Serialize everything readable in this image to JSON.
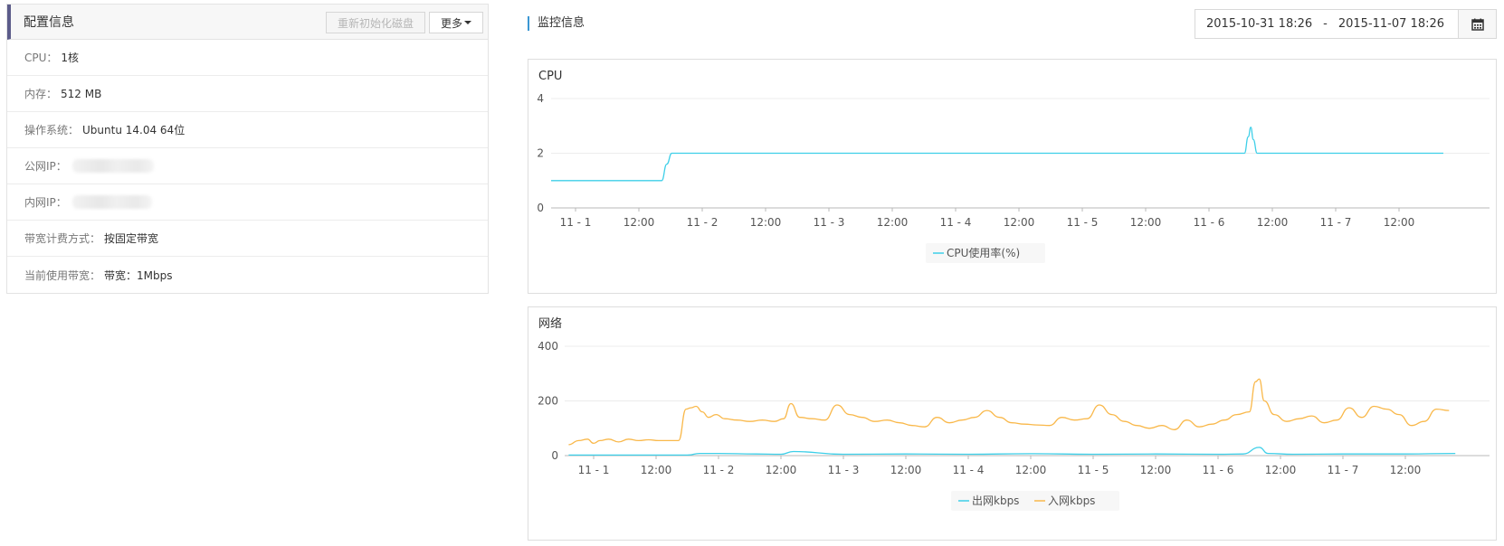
{
  "config": {
    "title": "配置信息",
    "reinit_label": "重新初始化磁盘",
    "more_label": "更多",
    "rows": [
      {
        "label": "CPU：",
        "value": "1核"
      },
      {
        "label": "内存：",
        "value": "512 MB"
      },
      {
        "label": "操作系统：",
        "value": "Ubuntu 14.04 64位"
      },
      {
        "label": "公网IP：",
        "value": ""
      },
      {
        "label": "内网IP：",
        "value": ""
      },
      {
        "label": "带宽计费方式：",
        "value": "按固定带宽"
      },
      {
        "label": "当前使用带宽：",
        "value": "带宽：1Mbps"
      }
    ]
  },
  "monitor": {
    "title": "监控信息",
    "date_start": "2015-10-31 18:26",
    "date_sep": "-",
    "date_end": "2015-11-07 18:26"
  },
  "colors": {
    "series_cyan": "#3ecfe8",
    "series_orange": "#f9b84a",
    "accent_blue": "#3b97d3",
    "header_bar": "#5c5c8a"
  },
  "chart_data": [
    {
      "type": "line",
      "title": "CPU",
      "x_ticks": [
        "11 - 1",
        "12:00",
        "11 - 2",
        "12:00",
        "11 - 3",
        "12:00",
        "11 - 4",
        "12:00",
        "11 - 5",
        "12:00",
        "11 - 6",
        "12:00",
        "11 - 7",
        "12:00"
      ],
      "ylim": [
        0,
        4
      ],
      "y_ticks": [
        0,
        2,
        4
      ],
      "grid": true,
      "legend_position": "bottom",
      "series": [
        {
          "name": "CPU使用率(%)",
          "color": "#3ecfe8",
          "x": [
            -0.3,
            0.3,
            0.68,
            0.72,
            0.76,
            1.0,
            2.0,
            3.0,
            4.0,
            5.0,
            5.28,
            5.31,
            5.33,
            5.35,
            5.38,
            6.0,
            6.6,
            6.85
          ],
          "values": [
            1.0,
            1.0,
            1.0,
            1.6,
            2.0,
            2.0,
            2.0,
            2.0,
            2.0,
            2.0,
            2.0,
            2.6,
            2.95,
            2.5,
            2.0,
            2.0,
            2.0,
            2.0
          ]
        }
      ]
    },
    {
      "type": "line",
      "title": "网络",
      "x_ticks": [
        "11 - 1",
        "12:00",
        "11 - 2",
        "12:00",
        "11 - 3",
        "12:00",
        "11 - 4",
        "12:00",
        "11 - 5",
        "12:00",
        "11 - 6",
        "12:00",
        "11 - 7",
        "12:00"
      ],
      "ylim": [
        0,
        400
      ],
      "y_ticks": [
        0,
        200,
        400
      ],
      "grid": true,
      "legend_position": "bottom",
      "series": [
        {
          "name": "出网kbps",
          "color": "#3ecfe8",
          "x": [
            -0.2,
            0.0,
            0.5,
            0.75,
            0.85,
            1.0,
            1.3,
            1.5,
            1.6,
            2.0,
            2.5,
            3.0,
            3.5,
            4.0,
            4.5,
            5.0,
            5.2,
            5.33,
            5.4,
            5.6,
            6.0,
            6.5,
            6.9
          ],
          "values": [
            2,
            2,
            2,
            2,
            8,
            8,
            6,
            5,
            15,
            5,
            6,
            5,
            7,
            5,
            6,
            5,
            6,
            30,
            8,
            5,
            6,
            6,
            8
          ]
        },
        {
          "name": "入网kbps",
          "color": "#f9b84a",
          "x": [
            -0.2,
            -0.12,
            -0.05,
            0.0,
            0.05,
            0.12,
            0.2,
            0.28,
            0.36,
            0.44,
            0.52,
            0.6,
            0.68,
            0.74,
            0.78,
            0.82,
            0.87,
            0.92,
            0.98,
            1.05,
            1.15,
            1.25,
            1.35,
            1.45,
            1.52,
            1.58,
            1.65,
            1.75,
            1.85,
            1.95,
            2.05,
            2.15,
            2.25,
            2.35,
            2.45,
            2.55,
            2.65,
            2.75,
            2.85,
            2.95,
            3.05,
            3.15,
            3.25,
            3.35,
            3.45,
            3.55,
            3.65,
            3.75,
            3.85,
            3.95,
            4.05,
            4.15,
            4.25,
            4.35,
            4.45,
            4.55,
            4.65,
            4.75,
            4.85,
            4.95,
            5.05,
            5.15,
            5.25,
            5.3,
            5.33,
            5.37,
            5.45,
            5.55,
            5.65,
            5.75,
            5.85,
            5.95,
            6.05,
            6.15,
            6.25,
            6.35,
            6.45,
            6.55,
            6.65,
            6.75,
            6.85
          ],
          "values": [
            40,
            55,
            60,
            45,
            55,
            60,
            50,
            60,
            55,
            58,
            55,
            55,
            55,
            170,
            175,
            180,
            160,
            140,
            150,
            135,
            130,
            125,
            130,
            125,
            135,
            190,
            140,
            135,
            130,
            185,
            150,
            140,
            125,
            130,
            120,
            110,
            105,
            140,
            120,
            130,
            140,
            165,
            140,
            120,
            115,
            112,
            110,
            140,
            130,
            135,
            185,
            150,
            125,
            110,
            100,
            110,
            95,
            130,
            105,
            115,
            130,
            150,
            160,
            270,
            280,
            200,
            150,
            125,
            135,
            145,
            120,
            130,
            175,
            140,
            180,
            170,
            150,
            110,
            125,
            170,
            165
          ]
        }
      ]
    }
  ]
}
